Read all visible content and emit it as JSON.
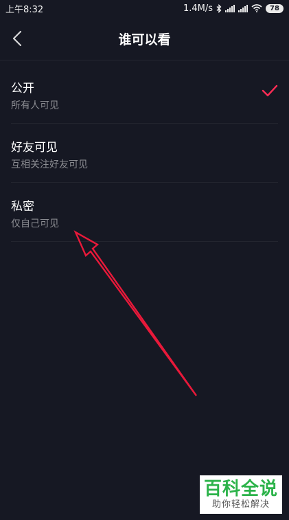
{
  "status_bar": {
    "time": "上午8:32",
    "net_speed": "1.4M/s",
    "battery": "78"
  },
  "nav": {
    "title": "谁可以看"
  },
  "options": [
    {
      "title": "公开",
      "subtitle": "所有人可见",
      "selected": true
    },
    {
      "title": "好友可见",
      "subtitle": "互相关注好友可见",
      "selected": false
    },
    {
      "title": "私密",
      "subtitle": "仅自己可见",
      "selected": false
    }
  ],
  "watermark": {
    "main": "百科全说",
    "sub": "助你轻松解决"
  },
  "colors": {
    "background": "#161823",
    "accent": "#fe2c55",
    "annotation": "#e8193a",
    "watermark_green": "#2cb34a"
  }
}
